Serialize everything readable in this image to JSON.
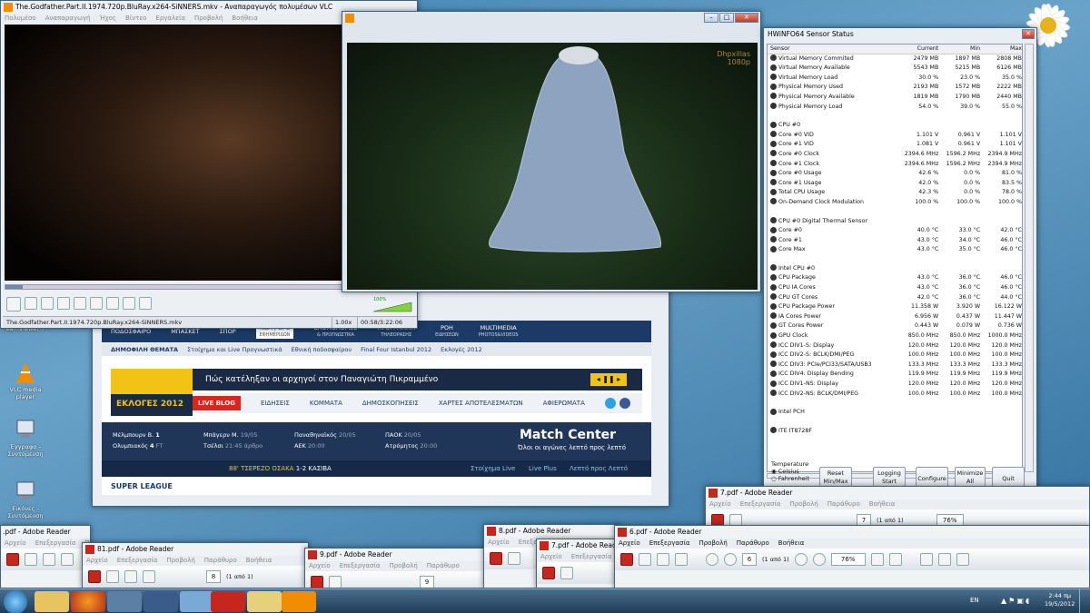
{
  "vlc": {
    "title": "The.Godfather.Part.II.1974.720p.BluRay.x264-SiNNERS.mkv - Αναπαραγωγός πολυμέσων VLC",
    "menu": [
      "Πολυμέσο",
      "Αναπαραγωγή",
      "Ήχος",
      "Βίντεο",
      "Εργαλεία",
      "Προβολή",
      "Βοήθεια"
    ],
    "status_file": "The.Godfather.Part.II.1974.720p.BluRay.x264-SiNNERS.mkv",
    "speed": "1.00x",
    "time": "00:58/3:22:06",
    "volume": "100%"
  },
  "vlc2": {
    "watermark_1": "Dhpxillas",
    "watermark_2": "1080p"
  },
  "hw": {
    "title": "HWiNFO64 Sensor Status",
    "headers": [
      "Sensor",
      "Current",
      "Min",
      "Max"
    ],
    "groups": [
      {
        "name": "",
        "rows": [
          [
            "Virtual Memory Commited",
            "2479 MB",
            "1897 MB",
            "2808 MB"
          ],
          [
            "Virtual Memory Available",
            "5543 MB",
            "5215 MB",
            "6126 MB"
          ],
          [
            "Virtual Memory Load",
            "30.0 %",
            "23.0 %",
            "35.0 %"
          ],
          [
            "Physical Memory Used",
            "2193 MB",
            "1572 MB",
            "2222 MB"
          ],
          [
            "Physical Memory Available",
            "1819 MB",
            "1790 MB",
            "2440 MB"
          ],
          [
            "Physical Memory Load",
            "54.0 %",
            "39.0 %",
            "55.0 %"
          ]
        ]
      },
      {
        "name": "CPU #0",
        "rows": [
          [
            "Core #0 VID",
            "1.101 V",
            "0.961 V",
            "1.101 V"
          ],
          [
            "Core #1 VID",
            "1.081 V",
            "0.961 V",
            "1.101 V"
          ],
          [
            "Core #0 Clock",
            "2394.6 MHz",
            "1596.2 MHz",
            "2394.9 MHz"
          ],
          [
            "Core #1 Clock",
            "2394.6 MHz",
            "1596.2 MHz",
            "2394.9 MHz"
          ],
          [
            "Core #0 Usage",
            "42.6 %",
            "0.0 %",
            "81.0 %"
          ],
          [
            "Core #1 Usage",
            "42.0 %",
            "0.0 %",
            "83.5 %"
          ],
          [
            "Total CPU Usage",
            "42.3 %",
            "0.0 %",
            "78.0 %"
          ],
          [
            "On-Demand Clock Modulation",
            "100.0 %",
            "100.0 %",
            "100.0 %"
          ]
        ]
      },
      {
        "name": "CPU #0 Digital Thermal Sensor",
        "rows": [
          [
            "Core #0",
            "40.0 °C",
            "33.0 °C",
            "42.0 °C"
          ],
          [
            "Core #1",
            "43.0 °C",
            "34.0 °C",
            "46.0 °C"
          ],
          [
            "Core Max",
            "43.0 °C",
            "35.0 °C",
            "46.0 °C"
          ]
        ]
      },
      {
        "name": "Intel CPU #0",
        "rows": [
          [
            "CPU Package",
            "43.0 °C",
            "36.0 °C",
            "46.0 °C"
          ],
          [
            "CPU IA Cores",
            "43.0 °C",
            "36.0 °C",
            "46.0 °C"
          ],
          [
            "CPU GT Cores",
            "42.0 °C",
            "36.0 °C",
            "44.0 °C"
          ],
          [
            "CPU Package Power",
            "11.358 W",
            "3.920 W",
            "16.122 W"
          ],
          [
            "IA Cores Power",
            "6.956 W",
            "0.437 W",
            "11.447 W"
          ],
          [
            "GT Cores Power",
            "0.443 W",
            "0.079 W",
            "0.736 W"
          ],
          [
            "GPU Clock",
            "850.0 MHz",
            "850.0 MHz",
            "1000.0 MHz"
          ],
          [
            "ICC DIV1-S: Display",
            "120.0 MHz",
            "120.0 MHz",
            "120.0 MHz"
          ],
          [
            "ICC DIV2-S: BCLK/DMI/PEG",
            "100.0 MHz",
            "100.0 MHz",
            "100.0 MHz"
          ],
          [
            "ICC DIV3: PCIe/PCI33/SATA/USB3",
            "133.3 MHz",
            "133.3 MHz",
            "133.3 MHz"
          ],
          [
            "ICC DIV4: Display Bending",
            "119.9 MHz",
            "119.9 MHz",
            "119.9 MHz"
          ],
          [
            "ICC DIV1-NS: Display",
            "120.0 MHz",
            "120.0 MHz",
            "120.0 MHz"
          ],
          [
            "ICC DIV2-NS: BCLK/DMI/PEG",
            "100.0 MHz",
            "100.0 MHz",
            "100.0 MHz"
          ]
        ]
      },
      {
        "name": "Intel PCH",
        "rows": []
      },
      {
        "name": "ITE IT8728F",
        "rows": []
      }
    ],
    "temp_label": "Temperature",
    "celsius": "Celsius",
    "fahrenheit": "Fahrenheit",
    "buttons": [
      "Reset Min/Max",
      "Logging Start",
      "Configure",
      "Minimize All",
      "Quit"
    ]
  },
  "site": {
    "nav": [
      [
        "ΠΟΔΟΣΦΑΙΡΟ",
        ""
      ],
      [
        "ΜΠΑΣΚΕΤ",
        ""
      ],
      [
        "ΣΠΟΡ",
        ""
      ],
      [
        "NBA | UFC",
        ""
      ],
      [
        "ΒΑΘΜΟΛΟΓΙΕΣ",
        "& ΠΡΟΓΝΩΣΤΙΚΑ"
      ],
      [
        "ΠΡΟΓΡΑΜΜΑ",
        "ΤΗΛΕΟΡΑΣΗΣ"
      ],
      [
        "ΡΟΗ",
        "ΕΙΔΗΣΕΩΝ"
      ],
      [
        "MULTIMEDIA",
        "PHOTOS&VIDEOS"
      ]
    ],
    "nba_sub": "ΕΦΗΜΕΡΙΔΩΝ",
    "hot_label": "ΔΗΜΟΦΙΛΗ ΘΕΜΑΤΑ",
    "hot": [
      "Στοίχημα και Live Προγνωστικά",
      "Εθνική ποδοσφαίρου",
      "Final Four Istanbul 2012",
      "Εκλογές 2012"
    ],
    "elections": "ΕΚΛΟΓΕΣ 2012",
    "headline": "Πώς κατέληξαν οι αρχηγοί στον Παναγιώτη Πικραμμένο",
    "live_blog": "LIVE BLOG",
    "sub": [
      "ΕΙΔΗΣΕΙΣ",
      "ΚΟΜΜΑΤΑ",
      "ΔΗΜΟΣΚΟΠΗΣΕΙΣ",
      "ΧΑΡΤΕΣ ΑΠΟΤΕΛΕΣΜΑΤΩΝ",
      "ΑΦΙΕΡΩΜΑΤΑ"
    ],
    "m1": {
      "a": "Μέλμπουρν Β.",
      "as": "1",
      "b": "Ολυμπιακός",
      "bs": "4",
      "st": "FT"
    },
    "m2": {
      "a": "Μπάγερν Μ.",
      "b": "Τσέλσι",
      "d": "19/05",
      "t": "21:45",
      "n": "άρθρο"
    },
    "m3": {
      "a": "Παναθηναϊκός",
      "b": "ΑΕΚ",
      "d": "20/05",
      "t": "20:00"
    },
    "m4": {
      "a": "ΠΑΟΚ",
      "b": "Ατρόμητος",
      "d": "20/05",
      "t": "20:00"
    },
    "mc_title": "Match Center",
    "mc_sub": "Όλοι οι αγώνες λεπτό προς λεπτό",
    "live_min": "88'",
    "live_text": "ΤΣΕΡΕΖΟ ΟΣΑΚΑ",
    "live_score": "1-2 ΚΑΣΙΒΑ",
    "bet": "Στοίχημα Live",
    "plus": "Live Plus",
    "lpl": "Λεπτό προς Λεπτό",
    "super": "SUPER LEAGUE"
  },
  "reader_menu": [
    "Αρχείο",
    "Επεξεργασία",
    "Προβολή",
    "Παράθυρο",
    "Βοήθεια"
  ],
  "readers": [
    {
      "title": "7.pdf - Adobe Reader",
      "page": "7",
      "of": "(1 από 1)",
      "zoom": "76%"
    },
    {
      "title": "81.pdf - Adobe Reader",
      "page": "8",
      "of": "(1 από 1)"
    },
    {
      "title": "9.pdf - Adobe Reader",
      "page": "9"
    },
    {
      "title": "8.pdf - Adobe Reader"
    },
    {
      "title": "7.pdf - Adobe Reader"
    },
    {
      "title": "6.pdf - Adobe Reader",
      "page": "6",
      "of": "(1 από 1)",
      "zoom": "76%"
    },
    {
      "title": ".pdf - Adobe Reader"
    }
  ],
  "desktop": [
    {
      "label": "VLC media player"
    },
    {
      "label": "Έγγραφα - Συντόμευση"
    },
    {
      "label": "Εικόνες - Συντόμευση"
    },
    {
      "label": "eamViewer 7"
    }
  ],
  "tray": {
    "lang": "EN",
    "time": "2:44 πμ",
    "date": "19/5/2012"
  }
}
